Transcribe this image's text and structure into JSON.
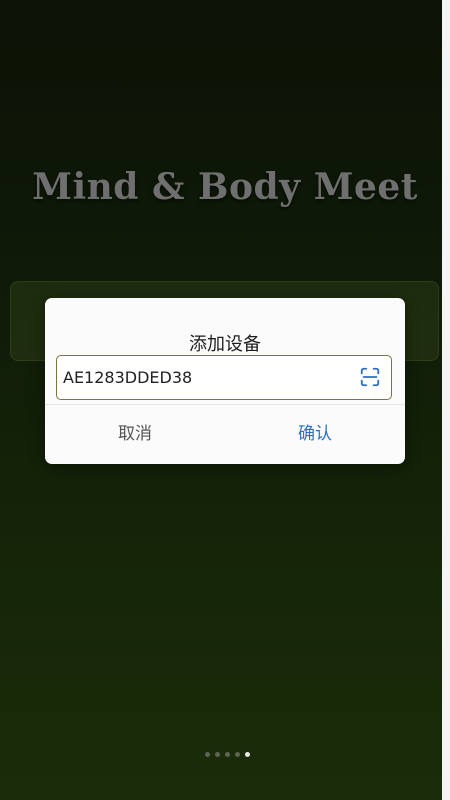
{
  "app": {
    "title": "Mind & Body Meet"
  },
  "dialog": {
    "title": "添加设备",
    "device_input_value": "AE1283DDED38",
    "scan_icon": "scan-icon",
    "cancel_label": "取消",
    "confirm_label": "确认",
    "confirm_color": "#2e6fc4",
    "input_border_color": "#6e7c3a"
  },
  "pager": {
    "count": 5,
    "active_index": 4
  }
}
